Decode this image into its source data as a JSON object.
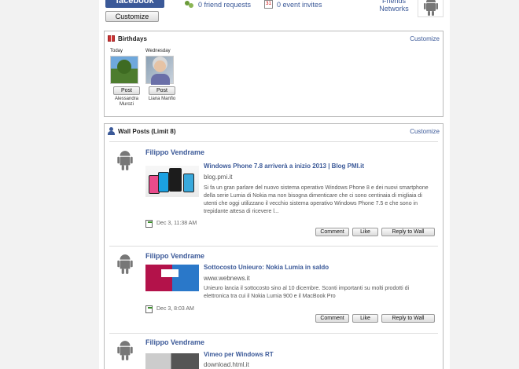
{
  "header": {
    "logo_text": "facebook",
    "customize_label": "Customize",
    "friend_requests": "0 friend requests",
    "event_invites": "0 event invites",
    "friends_networks": "Friends Networks",
    "calendar_icon_text": "31"
  },
  "birthdays": {
    "title": "Birthdays",
    "customize_label": "Customize",
    "people": [
      {
        "day": "Today",
        "name": "Alessandra Murozi",
        "post_label": "Post"
      },
      {
        "day": "Wednesday",
        "name": "Liana Manfio",
        "post_label": "Post"
      }
    ]
  },
  "wall": {
    "title": "Wall Posts (Limit 8)",
    "customize_label": "Customize",
    "actions": {
      "comment": "Comment",
      "like": "Like",
      "reply": "Reply to Wall"
    },
    "posts": [
      {
        "poster": "Filippo Vendrame",
        "link_title": "Windows Phone 7.8 arriverà a inizio 2013 | Blog PMI.it",
        "domain": "blog.pmi.it",
        "description": "Si fa un gran parlare del nuovo sistema operativo Windows Phone 8 e dei nuovi smartphone della serie Lumia di Nokia ma non bisogna dimenticare che ci sono centinaia di migliaia di utenti che oggi utilizzano il vecchio sistema operativo Windows Phone 7.5 e che sono in trepidante attesa di ricevere l...",
        "timestamp": "Dec 3, 11:38 AM"
      },
      {
        "poster": "Filippo Vendrame",
        "link_title": "Sottocosto Unieuro: Nokia Lumia in saldo",
        "domain": "www.webnews.it",
        "description": "Unieuro lancia il sottocosto sino al 10 dicembre. Sconti importanti su molti prodotti di elettronica tra cui il Nokia Lumia 900 e il MacBook Pro",
        "timestamp": "Dec 3, 8:03 AM"
      },
      {
        "poster": "Filippo Vendrame",
        "link_title": "Vimeo per Windows RT",
        "domain": "download.html.it",
        "description": "",
        "timestamp": ""
      }
    ]
  },
  "colors": {
    "link": "#3b5998",
    "panel_border": "#bbbbbb",
    "background": "#f2f2f2"
  }
}
